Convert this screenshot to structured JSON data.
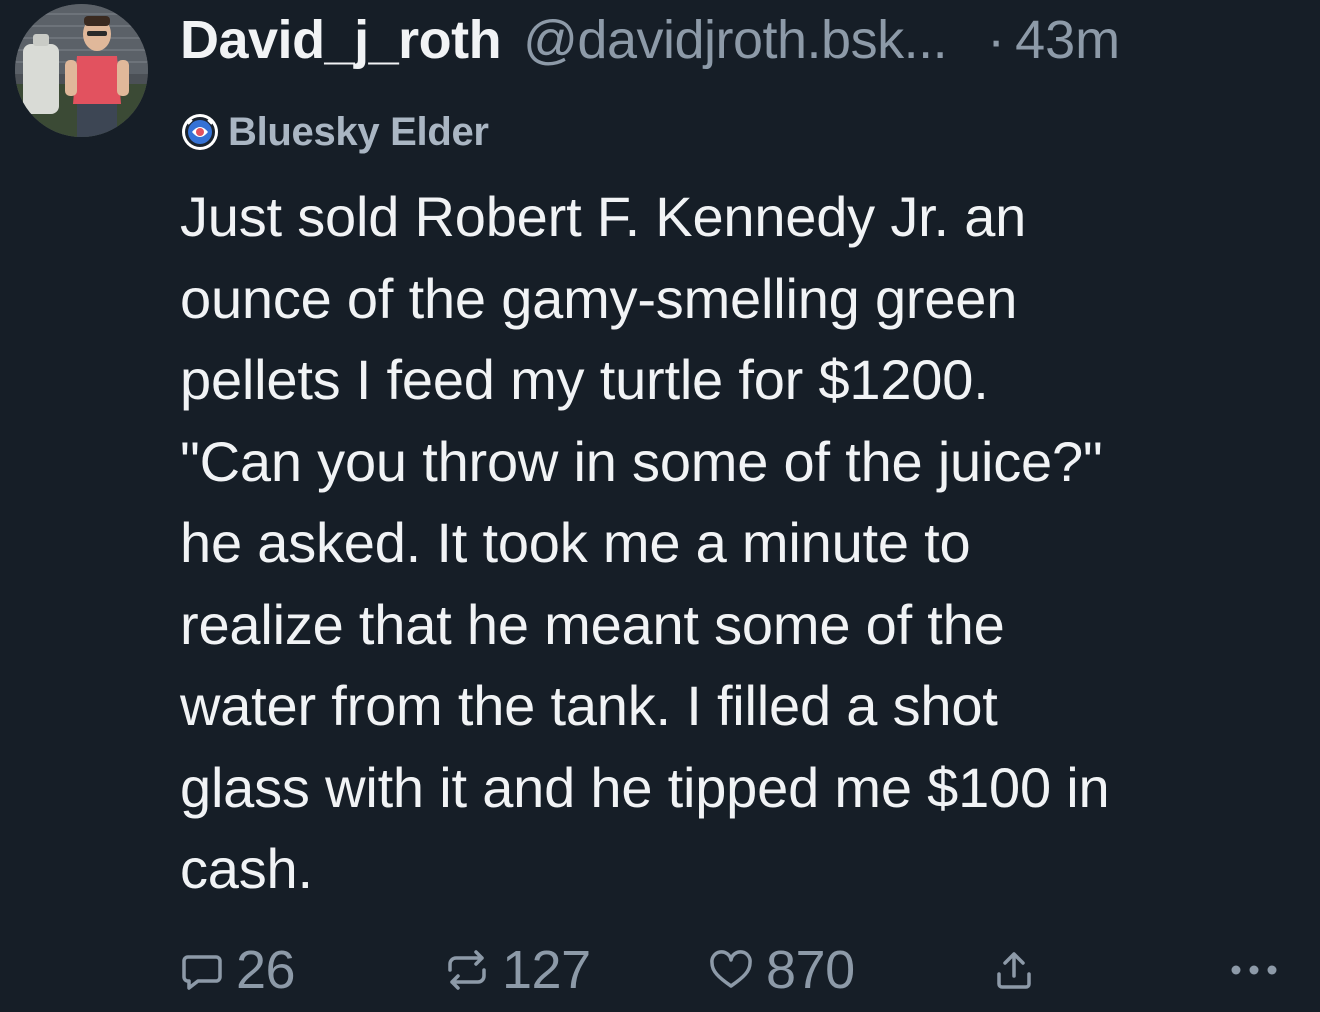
{
  "post": {
    "author": {
      "display_name": "David_j_roth",
      "handle": "@davidjroth.bsk...",
      "avatar_icon": "profile-photo"
    },
    "separator": "·",
    "timestamp": "43m",
    "badge": {
      "icon": "elder-badge-icon",
      "label": "Bluesky Elder"
    },
    "text_lines": [
      "Just sold Robert F. Kennedy Jr. an",
      "ounce of the gamy-smelling green",
      "pellets I feed my turtle for $1200.",
      "\"Can you throw in some of the juice?\"",
      "he asked. It took me a minute to",
      "realize that he meant some of the",
      "water from the tank. I filled a shot",
      "glass with it and he tipped me $100 in",
      "cash."
    ],
    "actions": {
      "replies": "26",
      "reposts": "127",
      "likes": "870",
      "share_icon": "share-icon",
      "more_icon": "more-options-icon"
    }
  },
  "colors": {
    "background": "#161e27",
    "text_primary": "#f1f3f5",
    "text_secondary": "#8d9aa8",
    "badge_text": "#aab6c3"
  }
}
